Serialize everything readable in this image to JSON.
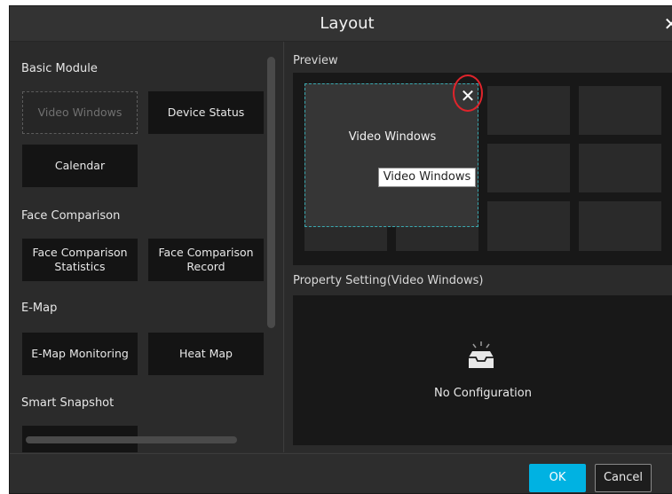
{
  "dialog": {
    "title": "Layout",
    "close_icon": "close-icon"
  },
  "left": {
    "sections": [
      {
        "title": "Basic Module",
        "modules": [
          "Video Windows",
          "Device Status",
          "Calendar"
        ]
      },
      {
        "title": "Face Comparison",
        "modules": [
          "Face Comparison Statistics",
          "Face Comparison Record"
        ]
      },
      {
        "title": "E-Map",
        "modules": [
          "E-Map Monitoring",
          "Heat Map"
        ]
      },
      {
        "title": "Smart Snapshot",
        "modules": [
          ""
        ]
      }
    ]
  },
  "right": {
    "preview_title": "Preview",
    "widget": {
      "label": "Video Windows",
      "close_glyph": "✕"
    },
    "tooltip": "Video Windows",
    "property_title": "Property Setting(Video Windows)",
    "empty_text": "No Configuration"
  },
  "footer": {
    "ok_label": "OK",
    "cancel_label": "Cancel"
  },
  "colors": {
    "accent": "#00b2e2",
    "highlight": "#e0242b",
    "widget_border": "#3aa9b0"
  }
}
